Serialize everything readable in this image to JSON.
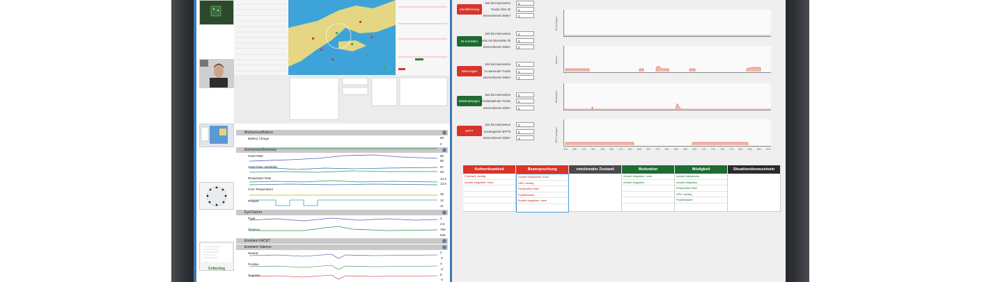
{
  "right_panel": {
    "buttons": [
      {
        "label": "Identifizierung",
        "color": "#d9332a"
      },
      {
        "label": "ID Korrektur",
        "color": "#1e6b34"
      },
      {
        "label": "Warnungen",
        "color": "#d9332a"
      },
      {
        "label": "Bekämpfungen",
        "color": "#1e6b34"
      },
      {
        "label": "NRTT",
        "color": "#d9332a"
      }
    ],
    "metric_groups": [
      {
        "rows": [
          {
            "label": "Zeit bis Intervention",
            "value": "0"
          },
          {
            "label": "Tracks ohne ID",
            "value": "2"
          },
          {
            "label": "Interventionen bisher",
            "value": "2"
          }
        ]
      },
      {
        "rows": [
          {
            "label": "Zeit bis Intervention",
            "value": "0"
          },
          {
            "label": "Tracks mit inkorrekter ID",
            "value": "0"
          },
          {
            "label": "Interventionen bisher",
            "value": "0"
          }
        ]
      },
      {
        "rows": [
          {
            "label": "Zeit bis Intervention",
            "value": "0"
          },
          {
            "label": "zu warnende Tracks",
            "value": "1"
          },
          {
            "label": "Interventionen bisher",
            "value": "2"
          }
        ]
      },
      {
        "rows": [
          {
            "label": "Zeit bis Intervention",
            "value": "0"
          },
          {
            "label": "zu bekämpfende Tracks",
            "value": "0"
          },
          {
            "label": "Interventionen bisher",
            "value": "0"
          }
        ]
      },
      {
        "rows": [
          {
            "label": "Zeit bis Intervention",
            "value": "0"
          },
          {
            "label": "anzulegende NRTTs",
            "value": "0"
          },
          {
            "label": "Interventionen bisher",
            "value": "4"
          }
        ]
      }
    ],
    "charts": [
      {
        "ylabel": "ID benötigen"
      },
      {
        "ylabel": "Warnen"
      },
      {
        "ylabel": "Bekämpfen"
      },
      {
        "ylabel": "NRTT anlegen"
      }
    ],
    "x_ticks": [
      "325",
      "350",
      "375",
      "400",
      "425",
      "450",
      "475",
      "500",
      "525",
      "550",
      "575",
      "600",
      "625",
      "650",
      "675",
      "700",
      "725",
      "750",
      "775",
      "800",
      "825",
      "850",
      "875"
    ]
  },
  "state_table": {
    "columns": [
      {
        "header": "Aufmerksamkeit",
        "color": "#d9332a",
        "items": [
          {
            "text": "Prioritaet: niedrig",
            "color": "#c0201a"
          },
          {
            "text": "Anzahl Aufgaben: hoch",
            "color": "#c0201a"
          }
        ]
      },
      {
        "header": "Beanspruchung",
        "color": "#d9332a",
        "items": [
          {
            "text": "Anzahl Mausklicks: hoch",
            "color": "#c0201a"
          },
          {
            "text": "HRV: niedrig",
            "color": "#c0201a"
          },
          {
            "text": "Respiration Rate",
            "color": "#c0201a"
          },
          {
            "text": "Pupillenweite",
            "color": "#c0201a"
          },
          {
            "text": "Anzahl Aufgaben: hoch",
            "color": "#c0201a"
          }
        ]
      },
      {
        "header": "emotionaler Zustand",
        "color": "#4a4a4a",
        "items": []
      },
      {
        "header": "Motivation",
        "color": "#1e6b34",
        "items": [
          {
            "text": "Anzahl Aufgaben: hoch",
            "color": "#1e6b34"
          },
          {
            "text": "Anzahl Aufgaben",
            "color": "#1e6b34"
          }
        ]
      },
      {
        "header": "Müdigkeit",
        "color": "#1e6b34",
        "items": [
          {
            "text": "Anzahl Mausklicks",
            "color": "#1e6b34"
          },
          {
            "text": "Anzahl Aufgaben",
            "color": "#1e6b34"
          },
          {
            "text": "Respiration Rate",
            "color": "#1e6b34"
          },
          {
            "text": "HRV: niedrig",
            "color": "#1e6b34"
          },
          {
            "text": "Pupillenweite",
            "color": "#1e6b34"
          }
        ]
      },
      {
        "header": "Situationsbewusstsein",
        "color": "#2b2b2b",
        "items": []
      }
    ]
  },
  "sensor_panels": {
    "battery": {
      "title": "BioharnessBattery",
      "signal": "Battery Charge",
      "v1": "80",
      "v2": "0"
    },
    "summary": {
      "title": "BioharnessSummary",
      "signals": [
        {
          "label": "Heart Rate",
          "v1": "85",
          "v2": "85"
        },
        {
          "label": "Heart Rate Variability",
          "v1": "97",
          "v2": "93"
        },
        {
          "label": "Respiration Rate",
          "v1": "14.4",
          "v2": "13.6"
        },
        {
          "label": "Core Temperature",
          "v1": "36",
          "v2": ""
        },
        {
          "label": "Posture",
          "v1": "12",
          "v2": "11"
        }
      ]
    },
    "eyetracker": {
      "title": "EyeTracker",
      "signals": [
        {
          "label": "Pupil",
          "v1": "3",
          "v2": "2.6"
        },
        {
          "label": "Distance",
          "v1": "700",
          "v2": "620"
        }
      ]
    },
    "facet": {
      "title": "Emotient FACET"
    },
    "valence": {
      "title": "Emotient Valence",
      "signals": [
        {
          "label": "Neutral",
          "v1": "2",
          "v2": "-2"
        },
        {
          "label": "Positive",
          "v1": "4",
          "v2": "-4"
        },
        {
          "label": "Negative",
          "v1": "8",
          "v2": "-2"
        }
      ]
    }
  },
  "thumb_panel": {
    "status": "Collecting"
  }
}
